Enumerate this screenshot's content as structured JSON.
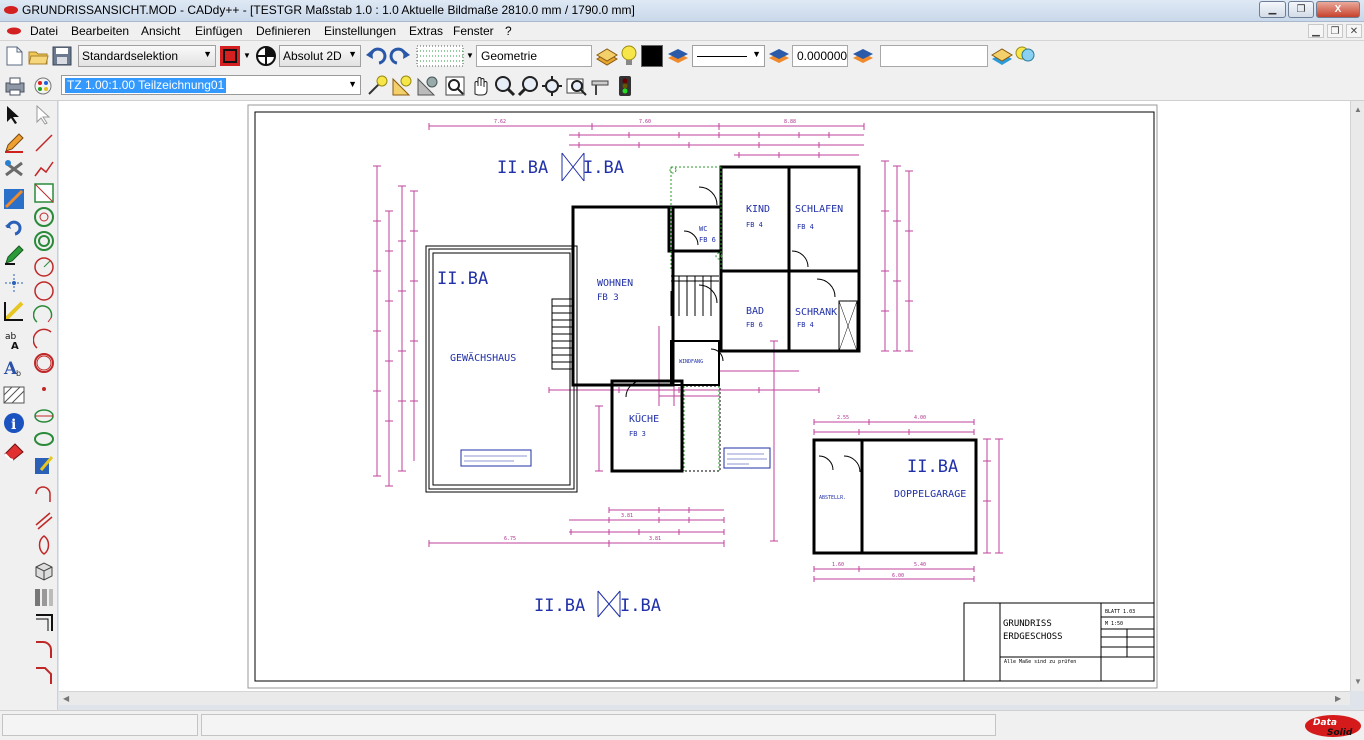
{
  "window": {
    "title": "GRUNDRISSANSICHT.MOD  - CADdy++ - [TESTGR    Maßstab 1.0 : 1.0    Aktuelle Bildmaße 2810.0 mm / 1790.0 mm]",
    "minimize_icon": "minimize-icon",
    "maximize_icon": "restore-icon",
    "close_label": "X"
  },
  "menu": {
    "items": [
      "Datei",
      "Bearbeiten",
      "Ansicht",
      "Einfügen",
      "Definieren",
      "Einstellungen",
      "Extras",
      "Fenster",
      "?"
    ]
  },
  "toolbar1": {
    "selection_mode": "Standardselektion",
    "coordinate_mode": "Absolut 2D",
    "layer_name": "Geometrie",
    "line_width_value": "0.000000",
    "empty_field": ""
  },
  "toolbar2": {
    "drawing_selector": "TZ 1.00:1.00 Teilzeichnung01"
  },
  "drawing": {
    "title_block": {
      "line1": "GRUNDRISS",
      "line2": "ERDGESCHOSS",
      "note": "Alle Maße sind zu prüfen",
      "sheet_id": "BLATT 1.03",
      "scale": "M 1:50"
    },
    "construction_labels": {
      "top": [
        "II.BA",
        "I.BA"
      ],
      "bottom": [
        "II.BA",
        "I.BA"
      ],
      "left_wing": "II.BA",
      "garage": "II.BA"
    },
    "rooms": [
      {
        "name": "KIND",
        "code": "FB 4"
      },
      {
        "name": "SCHLAFEN",
        "code": "FB 4"
      },
      {
        "name": "WC",
        "code": "FB 6"
      },
      {
        "name": "WOHNEN",
        "code": "FB 3"
      },
      {
        "name": "BAD",
        "code": "FB 6"
      },
      {
        "name": "SCHRANK",
        "code": "FB 4"
      },
      {
        "name": "GEWÄCHSHAUS",
        "code": ""
      },
      {
        "name": "KÜCHE",
        "code": "FB 3"
      },
      {
        "name": "DOPPELGARAGE",
        "code": ""
      },
      {
        "name": "WINDFANG",
        "code": ""
      },
      {
        "name": "ABSTELLR.",
        "code": ""
      }
    ],
    "dimension_labels": {
      "top": [
        "7.62",
        "7.60",
        "8.88"
      ],
      "bottom": [
        "3.81",
        "3.81",
        "6.75"
      ],
      "garage_top": [
        "2.55",
        "4.00"
      ],
      "garage_bottom": [
        "1.60",
        "5.40",
        "6.00"
      ]
    }
  },
  "status": {
    "left": "",
    "middle": "",
    "logo": "DataSolid"
  },
  "colors": {
    "walls": "#000000",
    "room_text": "#2030a8",
    "dimensions": "#c0409c",
    "green_markers": "#2a9a2a"
  }
}
